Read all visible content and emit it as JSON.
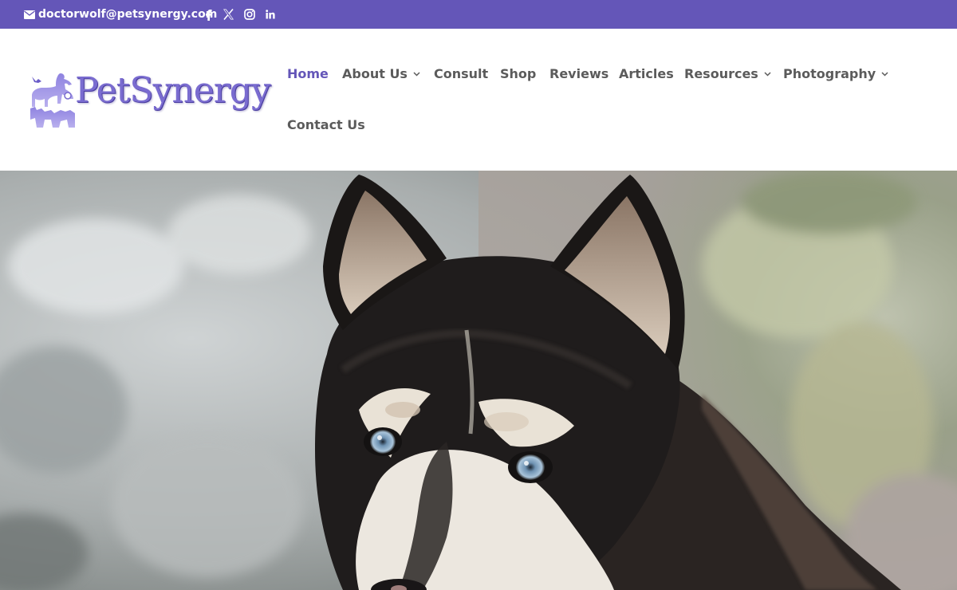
{
  "topbar": {
    "email": "doctorwolf@petsynergy.com",
    "email_icon": "envelope-icon",
    "social": [
      "facebook-icon",
      "x-twitter-icon",
      "instagram-icon",
      "linkedin-icon"
    ],
    "background": "#6456b8"
  },
  "header": {
    "logo_text": "PetSynergy",
    "logo_colors": [
      "#7a6cd0",
      "#4b3ea0"
    ]
  },
  "nav": {
    "active_color": "#6456b8",
    "text_color": "#5b5b5b",
    "items": [
      {
        "label": "Home",
        "active": true,
        "dropdown": false
      },
      {
        "label": "About Us",
        "active": false,
        "dropdown": true
      },
      {
        "label": "Consult",
        "active": false,
        "dropdown": false
      },
      {
        "label": "Shop",
        "active": false,
        "dropdown": false
      },
      {
        "label": "Reviews",
        "active": false,
        "dropdown": false
      },
      {
        "label": "Articles",
        "active": false,
        "dropdown": false
      },
      {
        "label": "Resources",
        "active": false,
        "dropdown": true
      },
      {
        "label": "Photography",
        "active": false,
        "dropdown": true
      },
      {
        "label": "Contact Us",
        "active": false,
        "dropdown": false
      }
    ]
  },
  "hero": {
    "subject": "siberian-husky-photo"
  }
}
